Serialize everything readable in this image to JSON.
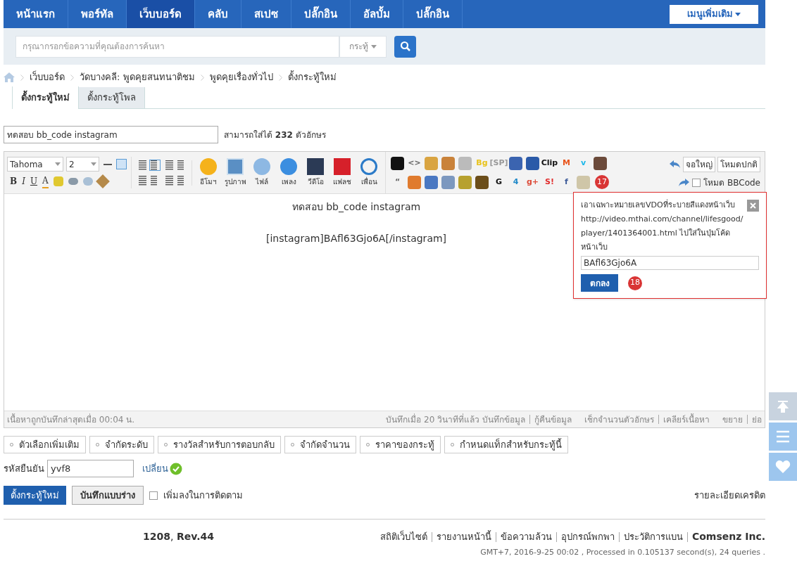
{
  "nav": {
    "items": [
      {
        "label": "หน้าแรก",
        "selected": false
      },
      {
        "label": "พอร์ทัล",
        "selected": false
      },
      {
        "label": "เว็บบอร์ด",
        "selected": true
      },
      {
        "label": "คลับ",
        "selected": false
      },
      {
        "label": "สเปซ",
        "selected": false
      },
      {
        "label": "ปลั๊กอิน",
        "selected": false
      },
      {
        "label": "อัลบั้ม",
        "selected": false
      },
      {
        "label": "ปลั๊กอิน",
        "selected": false
      }
    ],
    "more_menu": "เมนูเพิ่มเติม"
  },
  "search": {
    "placeholder": "กรุณากรอกข้อความที่คุณต้องการค้นหา",
    "scope": "กระทู้"
  },
  "breadcrumb": [
    "เว็บบอร์ด",
    "วัดบางคลี: พูดคุยสนทนาติชม",
    "พูดคุยเรื่องทั่วไป",
    "ตั้งกระทู้ใหม่"
  ],
  "tabs": [
    {
      "label": "ตั้งกระทู้ใหม่",
      "selected": true
    },
    {
      "label": "ตั้งกระทู้โพล",
      "selected": false
    }
  ],
  "subject": {
    "value": "ทดสอบ bb_code instagram",
    "hint": "สามารถใส่ได้ **232** ตัวอักษร"
  },
  "editor": {
    "font": "Tahoma",
    "size": "2",
    "format_buttons": [
      "B",
      "I",
      "U",
      "A"
    ],
    "media_buttons": [
      "อีโมฯ",
      "รูปภาพ",
      "ไฟล์",
      "เพลง",
      "วีดีโอ",
      "แฟลช",
      "เพื่อน"
    ],
    "icons_top": [
      {
        "kind": "icon",
        "color": "#111111"
      },
      {
        "kind": "glyph",
        "text": "<>",
        "color": "#666666"
      },
      {
        "kind": "icon",
        "color": "#d9a441"
      },
      {
        "kind": "icon",
        "color": "#c9823a"
      },
      {
        "kind": "icon",
        "color": "#bbbbbb"
      },
      {
        "kind": "glyph",
        "text": "Bg",
        "color": "#e8c21a"
      },
      {
        "kind": "glyph",
        "text": "[SP]",
        "color": "#999999"
      },
      {
        "kind": "icon",
        "color": "#3b64b0"
      },
      {
        "kind": "icon",
        "color": "#2a5aa8"
      },
      {
        "kind": "glyph",
        "text": "Clip",
        "color": "#111111"
      },
      {
        "kind": "glyph",
        "text": "M",
        "color": "#e8531a"
      },
      {
        "kind": "glyph",
        "text": "v",
        "color": "#1ab7ea"
      },
      {
        "kind": "icon",
        "color": "#6b4a3a"
      }
    ],
    "icons_bottom": [
      {
        "kind": "glyph",
        "text": "“",
        "color": "#666666"
      },
      {
        "kind": "icon",
        "color": "#e07b2e"
      },
      {
        "kind": "icon",
        "color": "#4a78c2"
      },
      {
        "kind": "icon",
        "color": "#7c98bf"
      },
      {
        "kind": "icon",
        "color": "#b7a12e"
      },
      {
        "kind": "icon",
        "color": "#6b4e1a"
      },
      {
        "kind": "glyph",
        "text": "G",
        "color": "#111111"
      },
      {
        "kind": "glyph",
        "text": "4",
        "color": "#1e88c8"
      },
      {
        "kind": "glyph",
        "text": "g+",
        "color": "#dd4b39"
      },
      {
        "kind": "glyph",
        "text": "S!",
        "color": "#e02a2a"
      },
      {
        "kind": "glyph",
        "text": "f",
        "color": "#3b5998"
      },
      {
        "kind": "icon",
        "color": "#cfc6a8"
      }
    ],
    "badge": "17",
    "fullscreen": "จอใหญ่",
    "normal_mode": "โหมดปกติ",
    "bbcode_mode": {
      "label": "โหมด BBCode",
      "checked": false
    },
    "content": [
      "ทดสอบ bb_code instagram",
      "[instagram]BAfl63Gjo6A[/instagram]"
    ],
    "popup": {
      "text": "เอาเฉพาะหมายเลขVDOที่ระบายสีแดงหน้าเว็บ http://video.mthai.com/channel/lifesgood/player/1401364001.html ไปใส่ในปุ่มโค้ดหน้าเว็บ",
      "value": "BAfl63Gjo6A",
      "ok": "ตกลง",
      "badge": "18"
    },
    "status_left": "เนื้อหาถูกบันทึกล่าสุดเมื่อ 00:04 น.",
    "status_right": [
      {
        "label": "บันทึกเมื่อ 20 วินาทีที่แล้ว บันทึกข้อมูล"
      },
      {
        "label": "กู้คืนข้อมูล"
      },
      {
        "label": "เช็กจำนวนตัวอักษร"
      },
      {
        "label": "เคลียร์เนื้อหา"
      },
      {
        "label": "ขยาย"
      },
      {
        "label": "ย่อ"
      }
    ]
  },
  "options": [
    "ตัวเลือกเพิ่มเติม",
    "จำกัดระดับ",
    "รางวัลสำหรับการตอบกลับ",
    "จำกัดจำนวน",
    "ราคาของกระทู้",
    "กำหนดแท็กสำหรับกระทู้นี้"
  ],
  "captcha": {
    "label": "รหัสยืนยัน",
    "value": "yvf8",
    "change": "เปลี่ยน"
  },
  "actions": {
    "submit": "ตั้งกระทู้ใหม่",
    "draft": "บันทึกแบบร่าง",
    "follow": {
      "label": "เพิ่มลงในการติดตาม",
      "checked": false
    },
    "credit_link": "รายละเอียดเครดิต"
  },
  "footer": {
    "version": "**1208**, **Rev.44**",
    "links": [
      "สถิติเว็บไซต์",
      "รายงานหน้านี้",
      "ข้อความล้วน",
      "อุปกรณ์พกพา",
      "ประวัติการแบน"
    ],
    "company": "Comsenz Inc.",
    "timestamp": "GMT+7, 2016-9-25 00:02 , Processed in 0.105137 second(s), 24 queries ."
  }
}
